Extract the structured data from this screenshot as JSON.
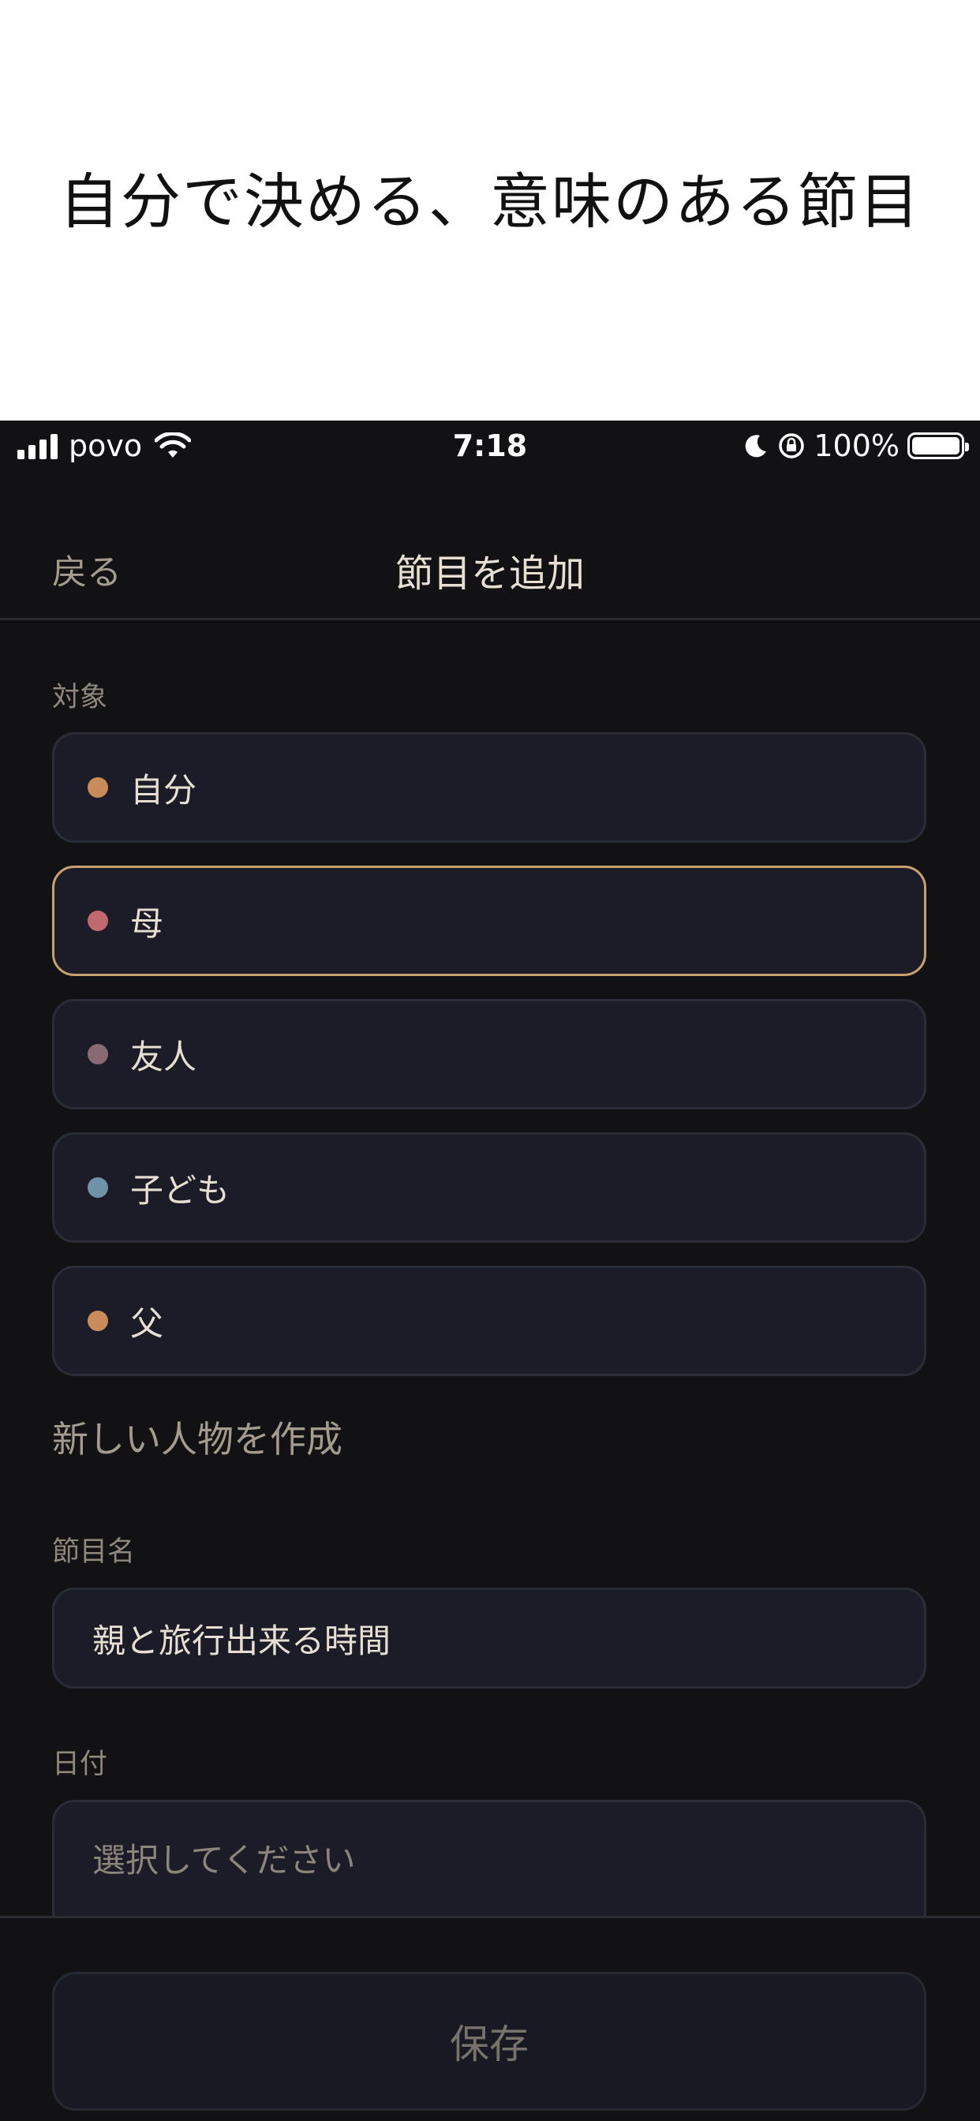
{
  "hero": {
    "title": "自分で決める、意味のある節目"
  },
  "status_bar": {
    "carrier": "povo",
    "time": "7:18",
    "battery": "100%"
  },
  "nav": {
    "back_label": "戻る",
    "title": "節目を追加"
  },
  "target_section": {
    "label": "対象",
    "persons": [
      {
        "name": "自分",
        "color": "#c98b5a",
        "selected": false
      },
      {
        "name": "母",
        "color": "#c06a70",
        "selected": true
      },
      {
        "name": "友人",
        "color": "#8a6a72",
        "selected": false
      },
      {
        "name": "子ども",
        "color": "#6f93a6",
        "selected": false
      },
      {
        "name": "父",
        "color": "#c98b5a",
        "selected": false
      }
    ],
    "create_label": "新しい人物を作成"
  },
  "milestone_name": {
    "label": "節目名",
    "value": "親と旅行出来る時間"
  },
  "date": {
    "label": "日付",
    "placeholder": "選択してください"
  },
  "save_label": "保存",
  "colors": {
    "background": "#121215",
    "card": "#1b1c27",
    "selected_border": "#c8a16e"
  }
}
